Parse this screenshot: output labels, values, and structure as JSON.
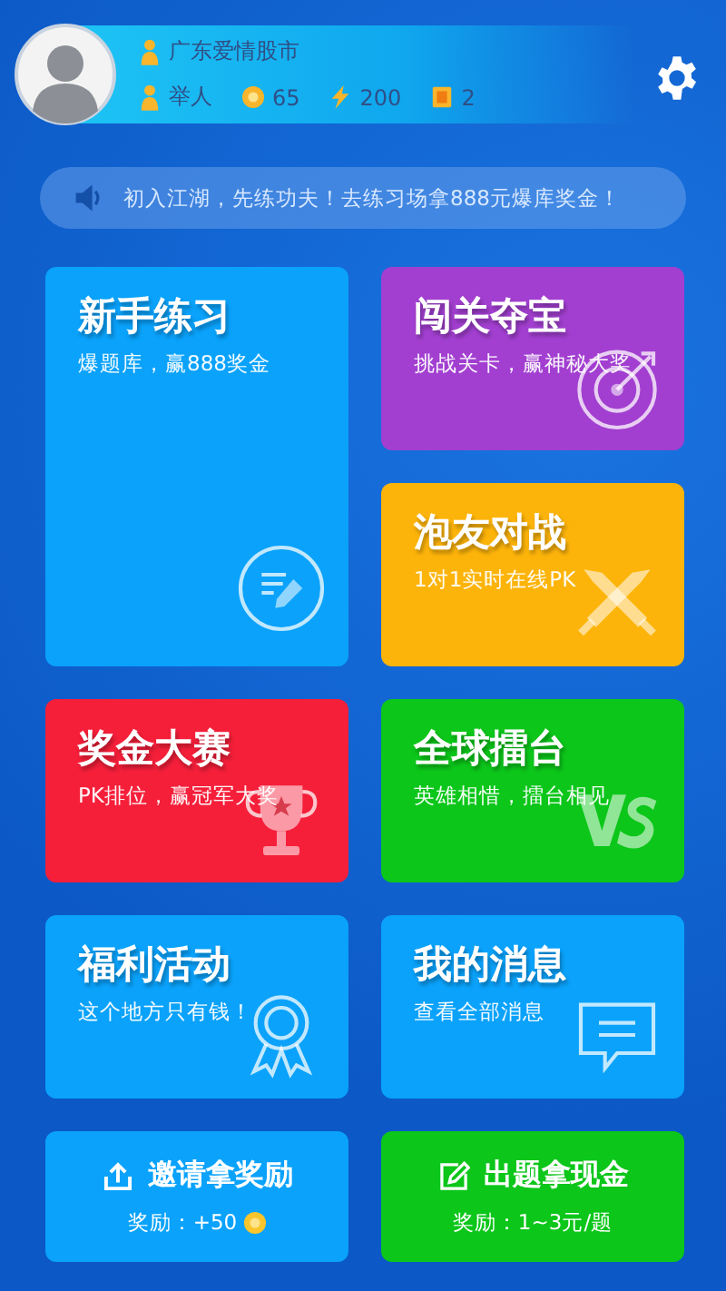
{
  "profile": {
    "name": "广东爱情股市",
    "rank": "举人",
    "coins": "65",
    "energy": "200",
    "cards": "2"
  },
  "notice": {
    "text": "初入江湖，先练功夫！去练习场拿888元爆库奖金！"
  },
  "cards": [
    {
      "title": "新手练习",
      "subtitle": "爆题库，赢888奖金",
      "color": "#0aa2fb",
      "kind": "practice"
    },
    {
      "title": "闯关夺宝",
      "subtitle": "挑战关卡，赢神秘大奖",
      "color": "#a23fd0",
      "kind": "target"
    },
    {
      "title": "泡友对战",
      "subtitle": "1对1实时在线PK",
      "color": "#fdb40a",
      "kind": "swords"
    },
    {
      "title": "奖金大赛",
      "subtitle": "PK排位，赢冠军大奖",
      "color": "#f51f3a",
      "kind": "trophy"
    },
    {
      "title": "全球擂台",
      "subtitle": "英雄相惜，擂台相见",
      "color": "#0cc61a",
      "kind": "versus"
    },
    {
      "title": "福利活动",
      "subtitle": "这个地方只有钱！",
      "color": "#0aa2fb",
      "kind": "medal"
    },
    {
      "title": "我的消息",
      "subtitle": "查看全部消息",
      "color": "#0aa2fb",
      "kind": "message"
    }
  ],
  "actions": [
    {
      "title": "邀请拿奖励",
      "reward": "奖励：+50",
      "color": "#0aa2fb",
      "kind": "invite",
      "coin": true
    },
    {
      "title": "出题拿现金",
      "reward": "奖励：1~3元/题",
      "color": "#0cc61a",
      "kind": "write",
      "coin": false
    }
  ]
}
